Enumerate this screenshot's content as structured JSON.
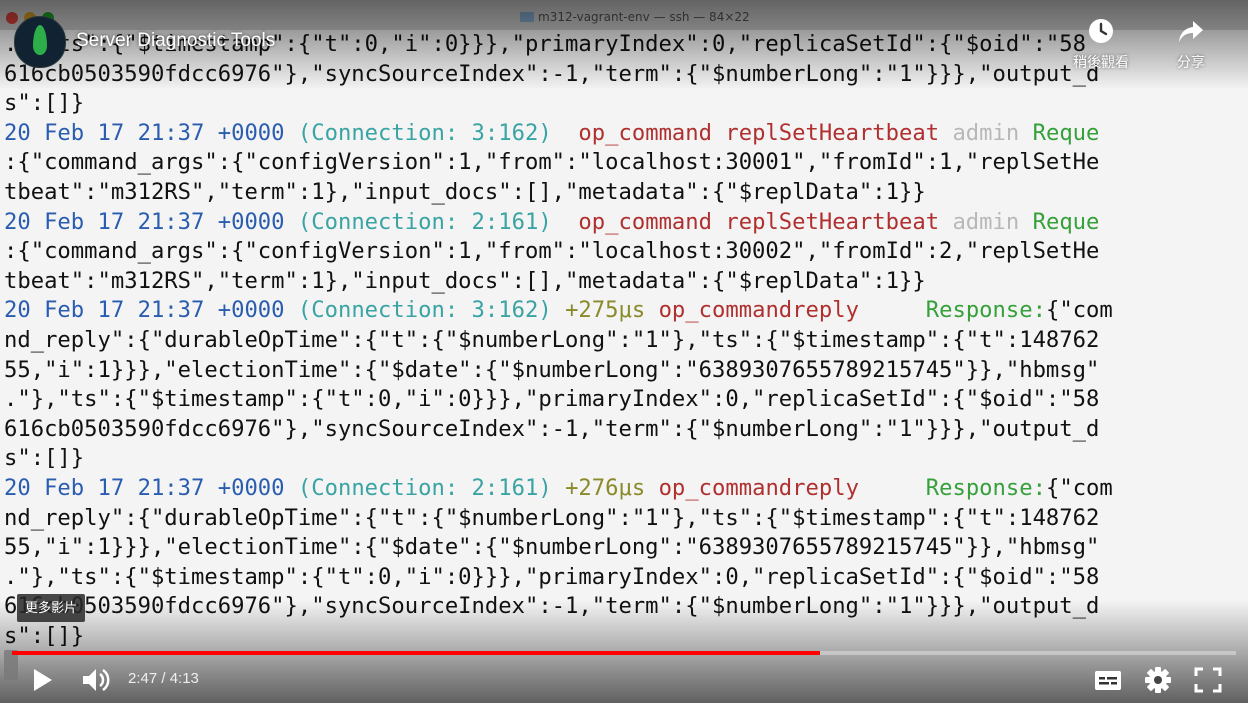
{
  "window": {
    "title": "m312-vagrant-env — ssh — 84×22"
  },
  "video": {
    "title": "Server Diagnostic Tools",
    "watch_later": "稍後觀看",
    "share": "分享",
    "more_videos": "更多影片",
    "current_time": "2:47",
    "duration": "4:13",
    "time_display": "2:47 / 4:13",
    "progress": 0.66
  },
  "terminal": {
    "lines": [
      ".\",\"ts\":{\"$timestamp\":{\"t\":0,\"i\":0}}},\"primaryIndex\":0,\"replicaSetId\":{\"$oid\":\"58",
      "616cb0503590fdcc6976\"},\"syncSourceIndex\":-1,\"term\":{\"$numberLong\":\"1\"}}},\"output_d",
      "s\":[]}",
      "20 Feb 17 21:37 +0000 (Connection: 3:162)  op_command replSetHeartbeat admin Reque",
      ":{\"command_args\":{\"configVersion\":1,\"from\":\"localhost:30001\",\"fromId\":1,\"replSetHe",
      "tbeat\":\"m312RS\",\"term\":1},\"input_docs\":[],\"metadata\":{\"$replData\":1}}",
      "20 Feb 17 21:37 +0000 (Connection: 2:161)  op_command replSetHeartbeat admin Reque",
      ":{\"command_args\":{\"configVersion\":1,\"from\":\"localhost:30002\",\"fromId\":2,\"replSetHe",
      "tbeat\":\"m312RS\",\"term\":1},\"input_docs\":[],\"metadata\":{\"$replData\":1}}",
      "20 Feb 17 21:37 +0000 (Connection: 3:162) +275μs op_commandreply     Response:{\"com",
      "nd_reply\":{\"durableOpTime\":{\"t\":{\"$numberLong\":\"1\"},\"ts\":{\"$timestamp\":{\"t\":148762",
      "55,\"i\":1}}},\"electionTime\":{\"$date\":{\"$numberLong\":\"6389307655789215745\"}},\"hbmsg\"",
      ".\"},\"ts\":{\"$timestamp\":{\"t\":0,\"i\":0}}},\"primaryIndex\":0,\"replicaSetId\":{\"$oid\":\"58",
      "616cb0503590fdcc6976\"},\"syncSourceIndex\":-1,\"term\":{\"$numberLong\":\"1\"}}},\"output_d",
      "s\":[]}",
      "20 Feb 17 21:37 +0000 (Connection: 2:161) +276μs op_commandreply     Response:{\"com",
      "nd_reply\":{\"durableOpTime\":{\"t\":{\"$numberLong\":\"1\"},\"ts\":{\"$timestamp\":{\"t\":148762",
      "55,\"i\":1}}},\"electionTime\":{\"$date\":{\"$numberLong\":\"6389307655789215745\"}},\"hbmsg\"",
      ".\"},\"ts\":{\"$timestamp\":{\"t\":0,\"i\":0}}},\"primaryIndex\":0,\"replicaSetId\":{\"$oid\":\"58",
      "616cb0503590fdcc6976\"},\"syncSourceIndex\":-1,\"term\":{\"$numberLong\":\"1\"}}},\"output_d",
      "s\":[]}"
    ]
  },
  "colors": {
    "progress": "#ff0000",
    "date": "#2a5db0",
    "connection": "#3aa3a3",
    "command": "#b03030",
    "admin": "#b8b8b8",
    "request": "#36a03a",
    "duration": "#8a8a2a"
  },
  "icons": {
    "play": "play-icon",
    "volume": "volume-icon",
    "subtitles": "subtitles-icon",
    "settings": "gear-icon",
    "fullscreen": "fullscreen-icon",
    "watch_later": "clock-icon",
    "share": "share-icon"
  }
}
